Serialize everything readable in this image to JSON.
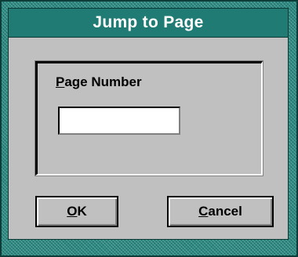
{
  "dialog": {
    "title": "Jump to Page",
    "field": {
      "label_mnemonic": "P",
      "label_rest": "age Number",
      "value": ""
    },
    "buttons": {
      "ok_mnemonic": "O",
      "ok_rest": "K",
      "cancel_mnemonic": "C",
      "cancel_rest": "ancel"
    }
  },
  "colors": {
    "frame": "#2a8a82",
    "titlebar": "#1f7b74",
    "face": "#c0c0c0"
  }
}
